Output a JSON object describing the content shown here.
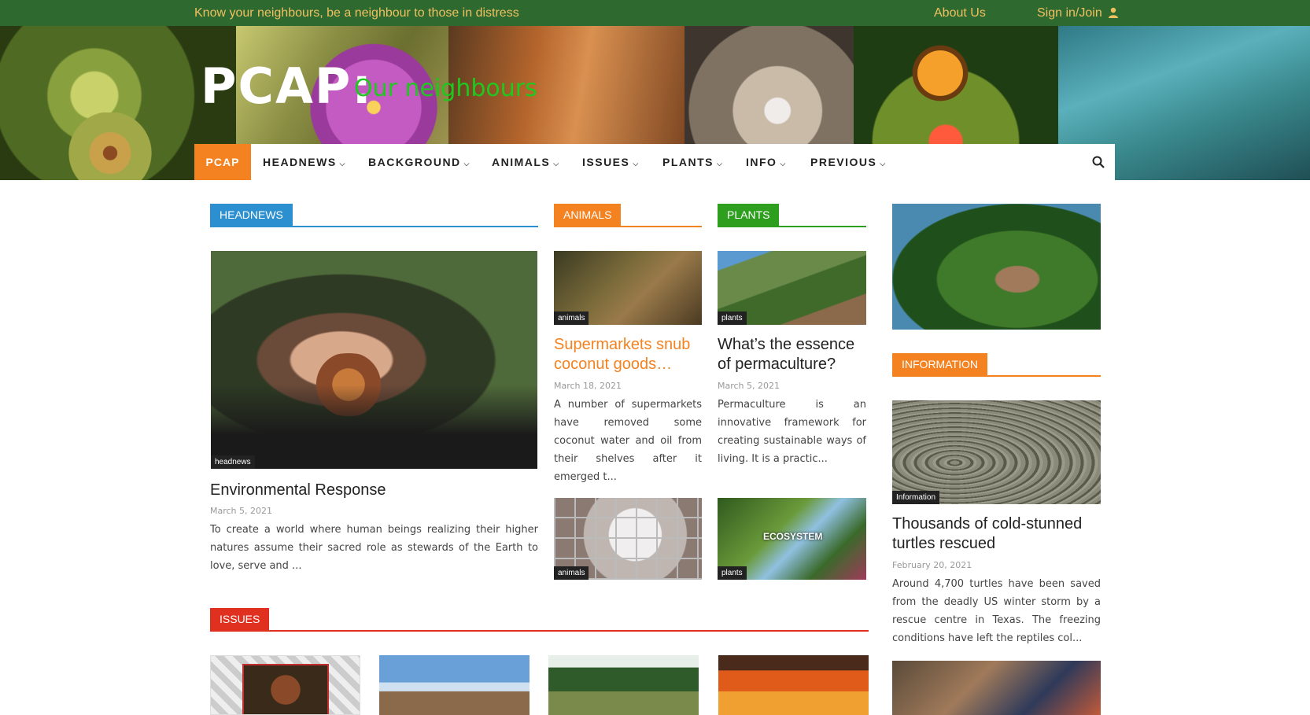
{
  "topbar": {
    "tagline": "Know your neighbours, be a neighbour to those in distress",
    "about": "About Us",
    "signin": "Sign in/Join"
  },
  "banner": {
    "logo": "PCAP:",
    "subtitle": "Our neighbours"
  },
  "nav": {
    "home": "PCAP",
    "items": [
      "HEADNEWS",
      "BACKGROUND",
      "ANIMALS",
      "ISSUES",
      "PLANTS",
      "INFO",
      "PREVIOUS"
    ]
  },
  "sections": {
    "headnews": "HEADNEWS",
    "animals": "ANIMALS",
    "plants": "PLANTS",
    "information": "INFORMATION",
    "issues": "ISSUES"
  },
  "colors": {
    "headnews": "#2b8fd0",
    "animals": "#f58220",
    "plants": "#2e9e1f",
    "information": "#f58220",
    "issues": "#e03020"
  },
  "posts": {
    "head": {
      "tag": "headnews",
      "title": "Environmental Response",
      "date": "March 5, 2021",
      "excerpt": "To create a world where human beings realizing their higher natures assume their sacred role as stewards of the Earth to love, serve and ..."
    },
    "animal1": {
      "tag": "animals",
      "title": "Supermarkets snub coconut goods…",
      "date": "March 18, 2021",
      "excerpt": "A number of supermarkets have removed some coconut water and oil from their shelves after it emerged t..."
    },
    "plant1": {
      "tag": "plants",
      "title": "What’s the essence of permaculture?",
      "date": "March 5, 2021",
      "excerpt": "Permaculture is an innovative framework for creating sustainable ways of living. It is a practic..."
    },
    "animal2": {
      "tag": "animals"
    },
    "plant2": {
      "tag": "plants",
      "overlay": "ECOSYSTEM"
    },
    "info1": {
      "tag": "Information",
      "title": "Thousands of cold-stunned turtles rescued",
      "date": "February 20, 2021",
      "excerpt": "Around 4,700 turtles have been saved from the deadly US winter storm by a rescue centre in Texas. The freezing conditions have left the reptiles col..."
    }
  },
  "icons": [
    "user-icon",
    "search-icon",
    "chevron-down-icon"
  ]
}
